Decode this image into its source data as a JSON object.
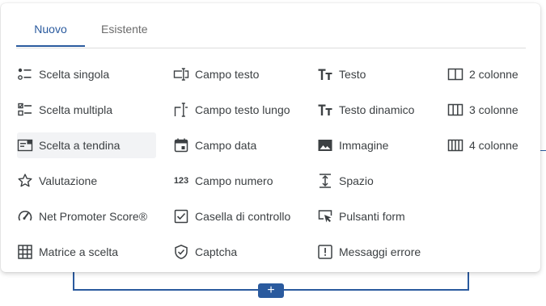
{
  "tabs": [
    {
      "label": "Nuovo",
      "active": true
    },
    {
      "label": "Esistente",
      "active": false
    }
  ],
  "columns": [
    [
      {
        "label": "Scelta singola",
        "icon": "single-choice-icon"
      },
      {
        "label": "Scelta multipla",
        "icon": "multiple-choice-icon"
      },
      {
        "label": "Scelta a tendina",
        "icon": "dropdown-icon",
        "highlighted": true
      },
      {
        "label": "Valutazione",
        "icon": "star-icon"
      },
      {
        "label": "Net Promoter Score®",
        "icon": "gauge-icon"
      },
      {
        "label": "Matrice a scelta",
        "icon": "grid-icon"
      }
    ],
    [
      {
        "label": "Campo testo",
        "icon": "text-field-icon"
      },
      {
        "label": "Campo testo lungo",
        "icon": "long-text-icon"
      },
      {
        "label": "Campo data",
        "icon": "calendar-icon"
      },
      {
        "label": "Campo numero",
        "icon": "number-icon",
        "icon_text": "123"
      },
      {
        "label": "Casella di controllo",
        "icon": "checkbox-icon"
      },
      {
        "label": "Captcha",
        "icon": "shield-check-icon"
      }
    ],
    [
      {
        "label": "Testo",
        "icon": "text-size-icon"
      },
      {
        "label": "Testo dinamico",
        "icon": "dynamic-text-icon"
      },
      {
        "label": "Immagine",
        "icon": "image-icon"
      },
      {
        "label": "Spazio",
        "icon": "spacing-icon"
      },
      {
        "label": "Pulsanti form",
        "icon": "click-button-icon"
      },
      {
        "label": "Messaggi errore",
        "icon": "alert-icon"
      }
    ],
    [
      {
        "label": "2 colonne",
        "icon": "two-columns-icon"
      },
      {
        "label": "3 colonne",
        "icon": "three-columns-icon"
      },
      {
        "label": "4 colonne",
        "icon": "four-columns-icon"
      }
    ]
  ],
  "add_button": {
    "label": "+"
  },
  "colors": {
    "accent": "#2a5a9e",
    "text": "#3c4043",
    "highlight": "#f2f3f5"
  }
}
